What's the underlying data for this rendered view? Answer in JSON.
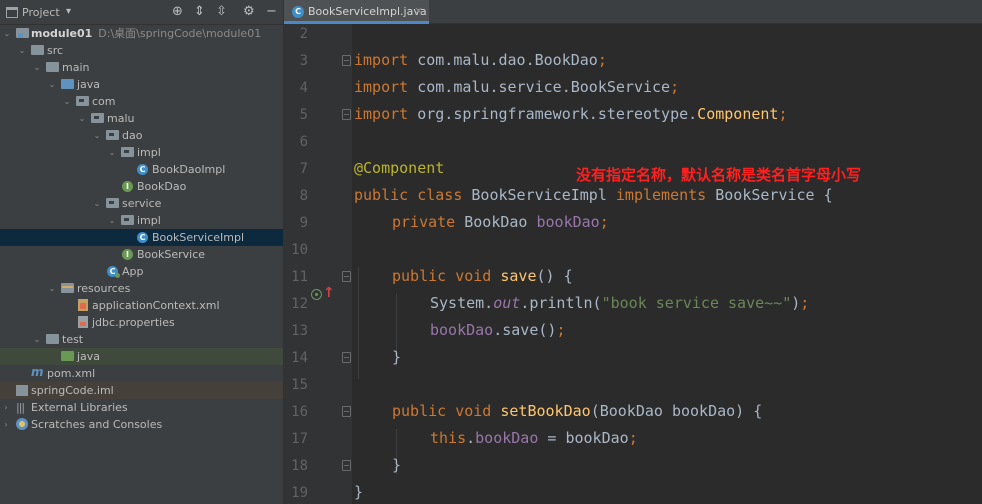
{
  "project_panel": {
    "title": "Project",
    "caret": "▾",
    "tools": {
      "locate": "⊕",
      "collapse": "⇕",
      "expand": "⇳",
      "settings": "⚙",
      "hide": "−"
    },
    "tree": [
      {
        "label": "module01",
        "path": "D:\\桌面\\springCode\\module01",
        "arrow": "⌄"
      },
      {
        "label": "src",
        "arrow": "⌄"
      },
      {
        "label": "main",
        "arrow": "⌄"
      },
      {
        "label": "java",
        "arrow": "⌄"
      },
      {
        "label": "com",
        "arrow": "⌄"
      },
      {
        "label": "malu",
        "arrow": "⌄"
      },
      {
        "label": "dao",
        "arrow": "⌄"
      },
      {
        "label": "impl",
        "arrow": "⌄"
      },
      {
        "label": "BookDaoImpl",
        "icon_text": "C"
      },
      {
        "label": "BookDao",
        "icon_text": "I"
      },
      {
        "label": "service",
        "arrow": "⌄"
      },
      {
        "label": "impl",
        "arrow": "⌄"
      },
      {
        "label": "BookServiceImpl",
        "icon_text": "C"
      },
      {
        "label": "BookService",
        "icon_text": "I"
      },
      {
        "label": "App",
        "icon_text": "C"
      },
      {
        "label": "resources",
        "arrow": "⌄"
      },
      {
        "label": "applicationContext.xml"
      },
      {
        "label": "jdbc.properties"
      },
      {
        "label": "test",
        "arrow": "⌄"
      },
      {
        "label": "java"
      },
      {
        "label": "pom.xml",
        "icon_text": "m"
      },
      {
        "label": "springCode.iml"
      },
      {
        "label": "External Libraries",
        "arrow": "›",
        "icon_text": "|||"
      },
      {
        "label": "Scratches and Consoles",
        "arrow": "›"
      }
    ]
  },
  "editor": {
    "tab": {
      "label": "BookServiceImpl.java",
      "icon_text": "C",
      "close": "×"
    },
    "line_numbers": [
      "2",
      "3",
      "4",
      "5",
      "6",
      "7",
      "8",
      "9",
      "10",
      "11",
      "12",
      "13",
      "14",
      "15",
      "16",
      "17",
      "18",
      "19"
    ],
    "gutter_marker": "↑",
    "code": {
      "l3": [
        "import",
        " com.malu.dao.BookDao",
        ";"
      ],
      "l4": [
        "import",
        " com.malu.service.BookService",
        ";"
      ],
      "l5": [
        "import",
        " org.springframework.stereotype.",
        "Component",
        ";"
      ],
      "l7": [
        "@Component"
      ],
      "l8": [
        "public class",
        " BookServiceImpl ",
        "implements",
        " BookService {"
      ],
      "l9": [
        "private",
        " BookDao ",
        "bookDao",
        ";"
      ],
      "l11": [
        "public void",
        " ",
        "save",
        "() {"
      ],
      "l12": [
        "System.",
        "out",
        ".println(",
        "\"book service save~~\"",
        ")",
        ";"
      ],
      "l13": [
        "bookDao",
        ".save()",
        ";"
      ],
      "l14": [
        "}"
      ],
      "l16": [
        "public void",
        " ",
        "setBookDao",
        "(BookDao bookDao) {"
      ],
      "l17": [
        "this",
        ".",
        "bookDao",
        " = bookDao",
        ";"
      ],
      "l18": [
        "}"
      ],
      "l19": [
        "}"
      ]
    },
    "annotation_note": "没有指定名称，默认名称是类名首字母小写"
  }
}
